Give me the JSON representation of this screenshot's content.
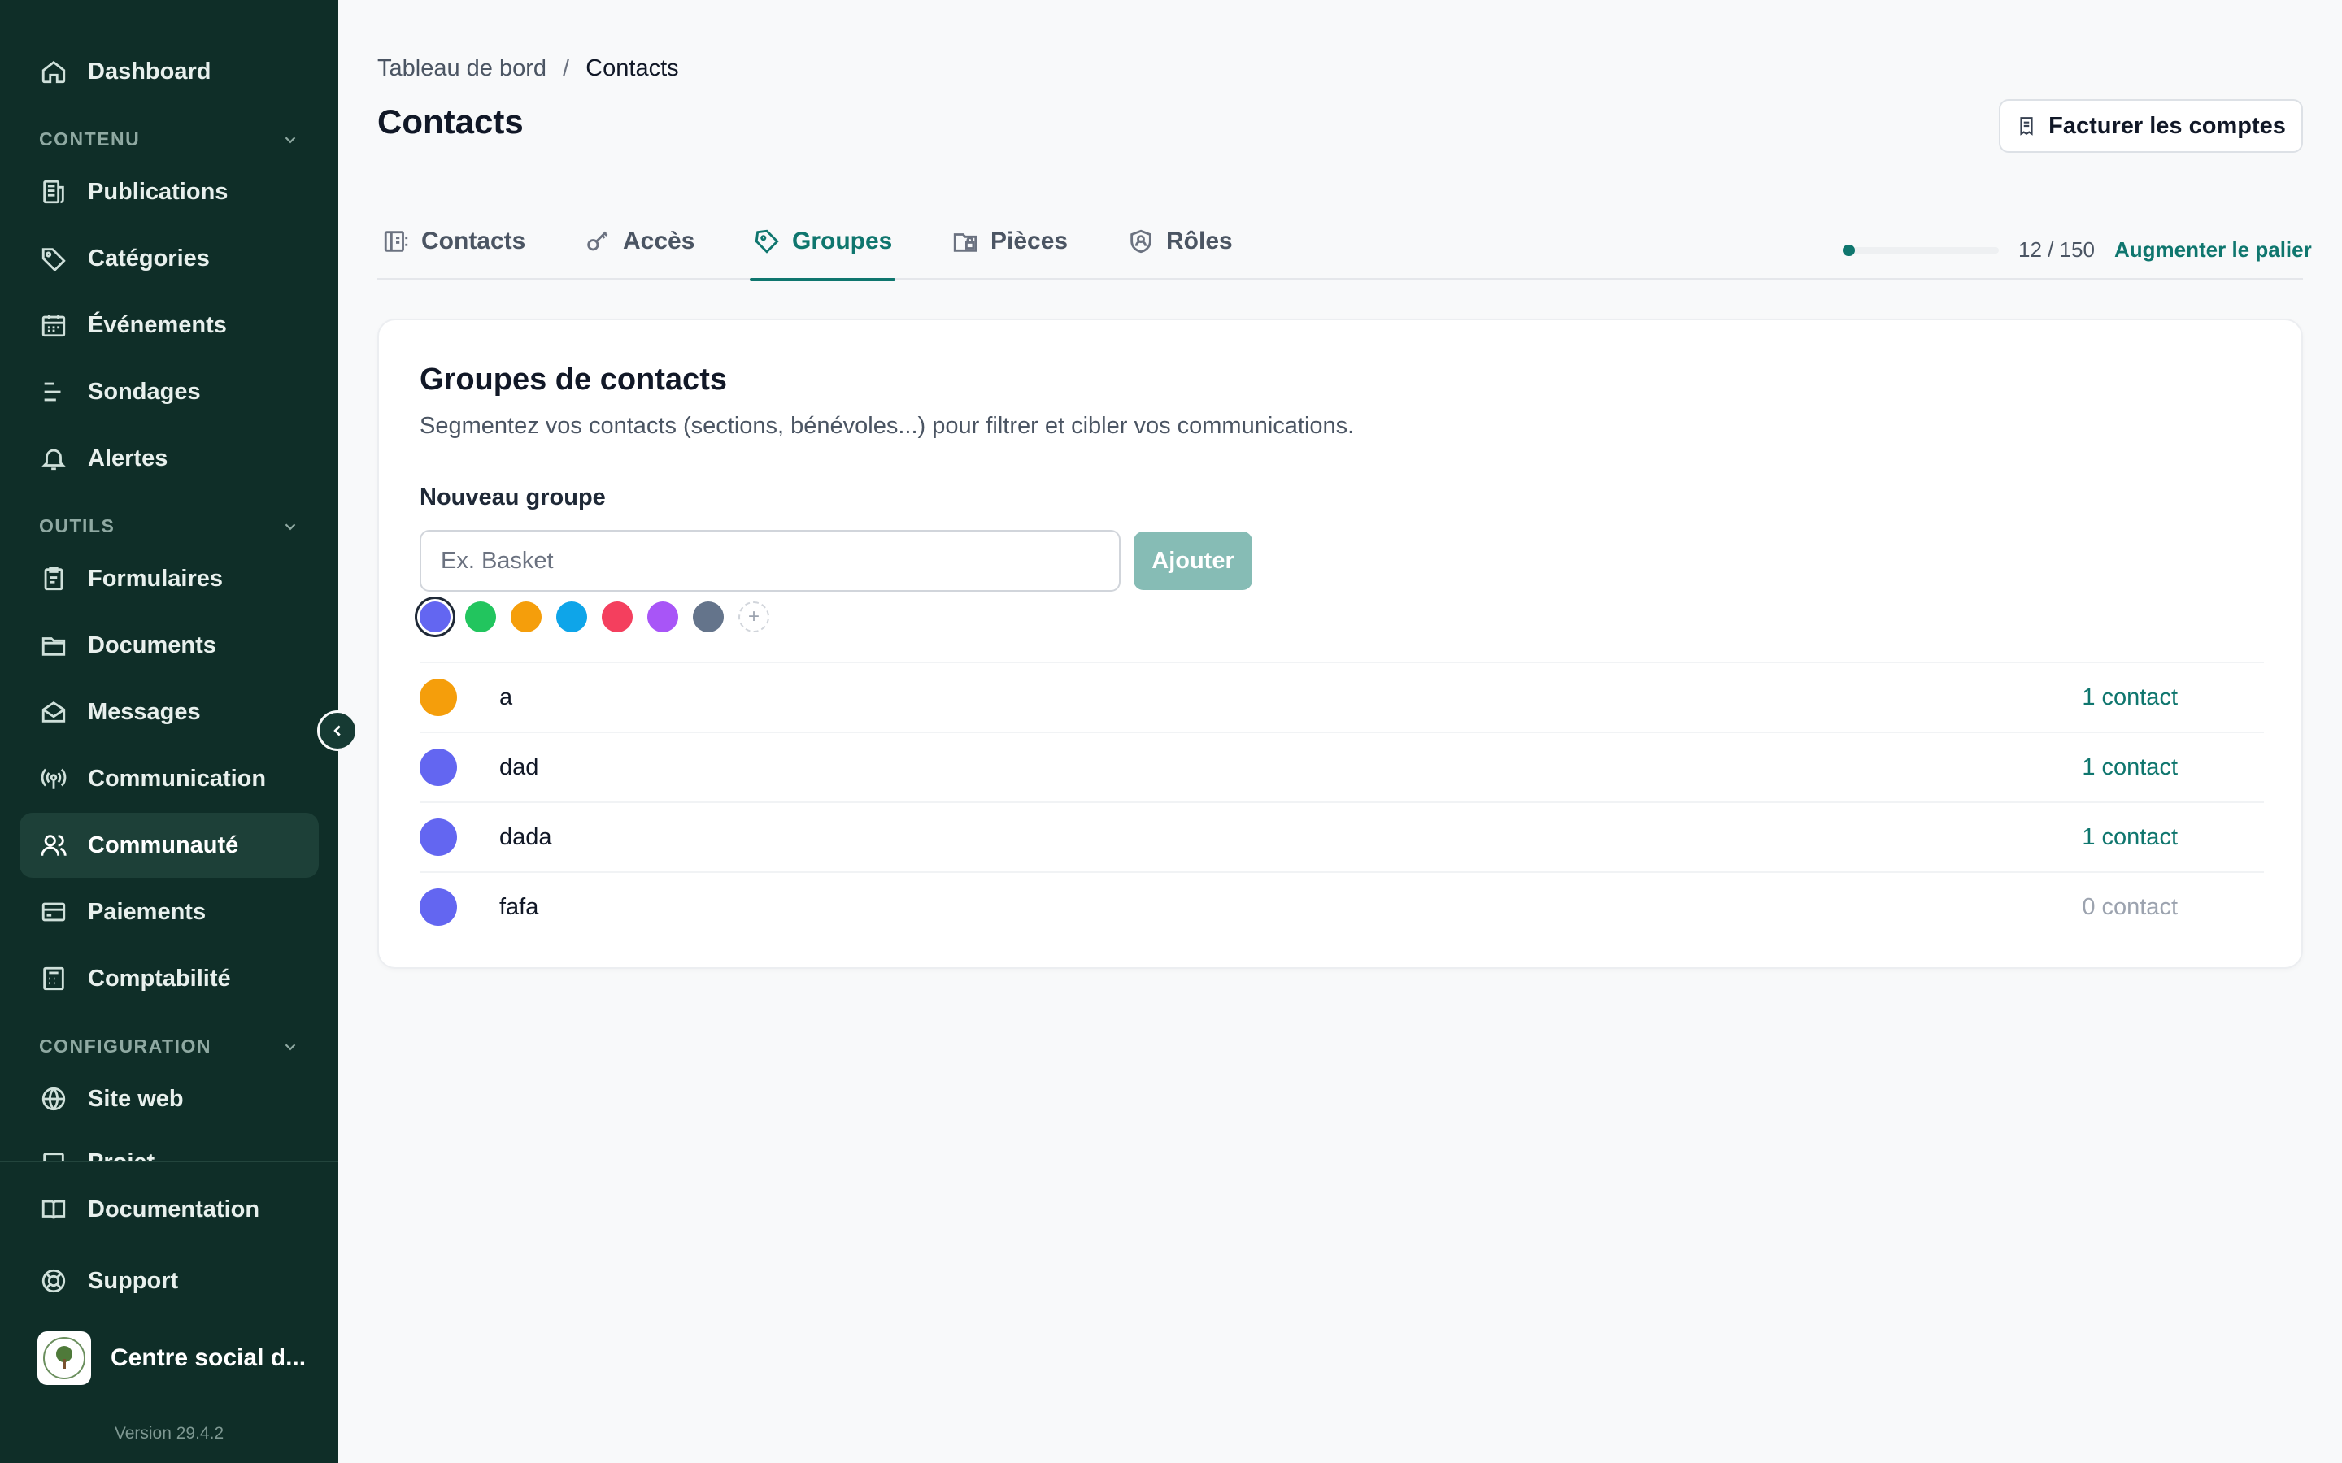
{
  "sidebar": {
    "top": [
      {
        "label": "Dashboard",
        "icon": "home-icon"
      }
    ],
    "sections": [
      {
        "label": "CONTENU",
        "items": [
          {
            "label": "Publications",
            "icon": "newspaper-icon"
          },
          {
            "label": "Catégories",
            "icon": "tag-icon"
          },
          {
            "label": "Événements",
            "icon": "calendar-icon"
          },
          {
            "label": "Sondages",
            "icon": "poll-icon"
          },
          {
            "label": "Alertes",
            "icon": "bell-icon"
          }
        ]
      },
      {
        "label": "OUTILS",
        "items": [
          {
            "label": "Formulaires",
            "icon": "clipboard-icon"
          },
          {
            "label": "Documents",
            "icon": "folder-icon"
          },
          {
            "label": "Messages",
            "icon": "mail-open-icon"
          },
          {
            "label": "Communication",
            "icon": "broadcast-icon"
          },
          {
            "label": "Communauté",
            "icon": "users-icon",
            "active": true
          },
          {
            "label": "Paiements",
            "icon": "card-icon"
          },
          {
            "label": "Comptabilité",
            "icon": "calculator-icon"
          }
        ]
      },
      {
        "label": "CONFIGURATION",
        "items": [
          {
            "label": "Site web",
            "icon": "globe-icon"
          },
          {
            "label": "Projet",
            "icon": "project-icon"
          }
        ]
      }
    ],
    "bottom": [
      {
        "label": "Documentation",
        "icon": "book-icon"
      },
      {
        "label": "Support",
        "icon": "lifebuoy-icon"
      }
    ],
    "org_name": "Centre social d...",
    "version": "Version 29.4.2"
  },
  "breadcrumb": {
    "parent": "Tableau de bord",
    "separator": "/",
    "current": "Contacts"
  },
  "page_title": "Contacts",
  "bill_button": "Facturer les comptes",
  "tabs": [
    {
      "label": "Contacts",
      "icon": "contacts-icon"
    },
    {
      "label": "Accès",
      "icon": "key-icon"
    },
    {
      "label": "Groupes",
      "icon": "tag-icon",
      "active": true
    },
    {
      "label": "Pièces",
      "icon": "folder-lock-icon"
    },
    {
      "label": "Rôles",
      "icon": "shield-user-icon"
    }
  ],
  "quota": {
    "used": 12,
    "total": 150,
    "text": "12 / 150",
    "link": "Augmenter le palier"
  },
  "card": {
    "title": "Groupes de contacts",
    "description": "Segmentez vos contacts (sections, bénévoles...) pour filtrer et cibler vos communications.",
    "new_group_label": "Nouveau groupe",
    "input_placeholder": "Ex. Basket",
    "add_button": "Ajouter",
    "colors": [
      "#6366f1",
      "#22c55e",
      "#f59e0b",
      "#0ea5e9",
      "#f43f5e",
      "#a855f7",
      "#64748b"
    ],
    "selected_color": "#6366f1",
    "add_color_symbol": "+",
    "groups": [
      {
        "name": "a",
        "color": "#f59e0b",
        "count": "1 contact"
      },
      {
        "name": "dad",
        "color": "#6366f1",
        "count": "1 contact"
      },
      {
        "name": "dada",
        "color": "#6366f1",
        "count": "1 contact"
      },
      {
        "name": "fafa",
        "color": "#6366f1",
        "count": "0 contact"
      }
    ]
  }
}
